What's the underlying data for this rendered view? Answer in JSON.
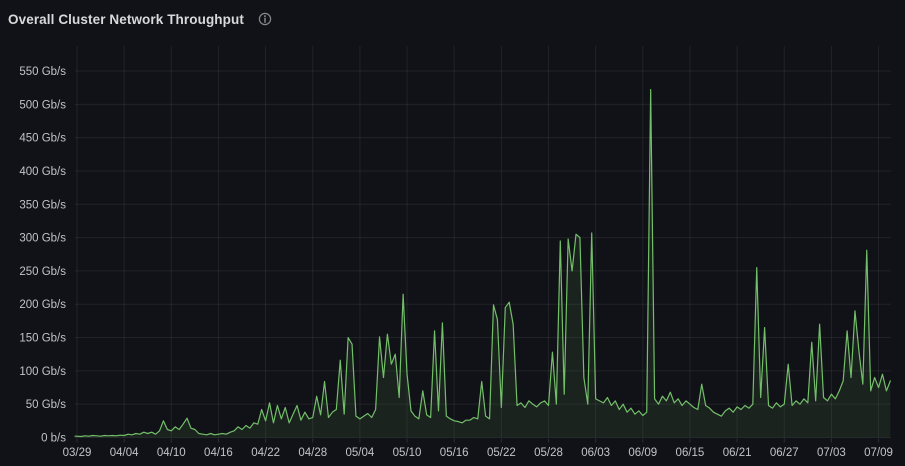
{
  "panel": {
    "title": "Overall Cluster Network Throughput",
    "info_icon": "info-circle-icon"
  },
  "colors": {
    "background": "#111217",
    "title_text": "#d8d9da",
    "axis_text": "#c2c3ca",
    "grid": "rgba(255,255,255,0.07)",
    "line": "#73BF69",
    "fill": "rgba(115,191,105,0.10)"
  },
  "chart_data": {
    "type": "area",
    "title": "Overall Cluster Network Throughput",
    "unit": "Gb/s",
    "legend": false,
    "grid": true,
    "ylim": [
      0,
      550
    ],
    "y_tick_values": [
      0,
      50,
      100,
      150,
      200,
      250,
      300,
      350,
      400,
      450,
      500,
      550
    ],
    "y_tick_labels": [
      "0 b/s",
      "50 Gb/s",
      "100 Gb/s",
      "150 Gb/s",
      "200 Gb/s",
      "250 Gb/s",
      "300 Gb/s",
      "350 Gb/s",
      "400 Gb/s",
      "450 Gb/s",
      "500 Gb/s",
      "550 Gb/s"
    ],
    "x_tick_labels": [
      "03/29",
      "04/04",
      "04/10",
      "04/16",
      "04/22",
      "04/28",
      "05/04",
      "05/10",
      "05/16",
      "05/22",
      "05/28",
      "06/03",
      "06/09",
      "06/15",
      "06/21",
      "06/27",
      "07/03",
      "07/09"
    ],
    "x_tick_interval_days": 6,
    "series": [
      {
        "name": "Overall Cluster Network Throughput",
        "unit": "Gb/s",
        "start_date": "03/29",
        "day_start": 0,
        "day_step": 0.5,
        "values": [
          2,
          1.5,
          2.5,
          2,
          3,
          2.5,
          2,
          3,
          2.5,
          3,
          2.5,
          3.5,
          3,
          5,
          4,
          6,
          5,
          8,
          6,
          8,
          5,
          10,
          25,
          12,
          10,
          16,
          12,
          20,
          29,
          14,
          12,
          6,
          5,
          4,
          6,
          4,
          5,
          6,
          5,
          8,
          10,
          16,
          12,
          18,
          14,
          22,
          20,
          42,
          25,
          52,
          22,
          48,
          28,
          45,
          22,
          35,
          48,
          26,
          38,
          28,
          30,
          62,
          34,
          84,
          30,
          38,
          42,
          116,
          35,
          150,
          140,
          32,
          28,
          32,
          36,
          30,
          42,
          151,
          90,
          155,
          110,
          125,
          60,
          215,
          95,
          40,
          32,
          28,
          70,
          34,
          30,
          160,
          40,
          172,
          32,
          28,
          25,
          24,
          22,
          26,
          26,
          30,
          28,
          84,
          32,
          28,
          199,
          177,
          45,
          195,
          203,
          170,
          48,
          52,
          45,
          55,
          50,
          46,
          52,
          55,
          48,
          128,
          50,
          295,
          65,
          298,
          250,
          305,
          300,
          90,
          50,
          307,
          58,
          55,
          52,
          60,
          48,
          55,
          42,
          50,
          38,
          44,
          35,
          40,
          33,
          38,
          522,
          58,
          50,
          62,
          55,
          68,
          52,
          58,
          48,
          55,
          50,
          45,
          42,
          80,
          48,
          44,
          38,
          35,
          32,
          40,
          44,
          38,
          46,
          42,
          48,
          44,
          50,
          255,
          60,
          165,
          48,
          44,
          52,
          46,
          50,
          110,
          48,
          55,
          50,
          58,
          52,
          143,
          55,
          170,
          60,
          55,
          65,
          58,
          70,
          85,
          160,
          90,
          190,
          130,
          80,
          281,
          70,
          90,
          75,
          95,
          70,
          85
        ]
      }
    ]
  }
}
